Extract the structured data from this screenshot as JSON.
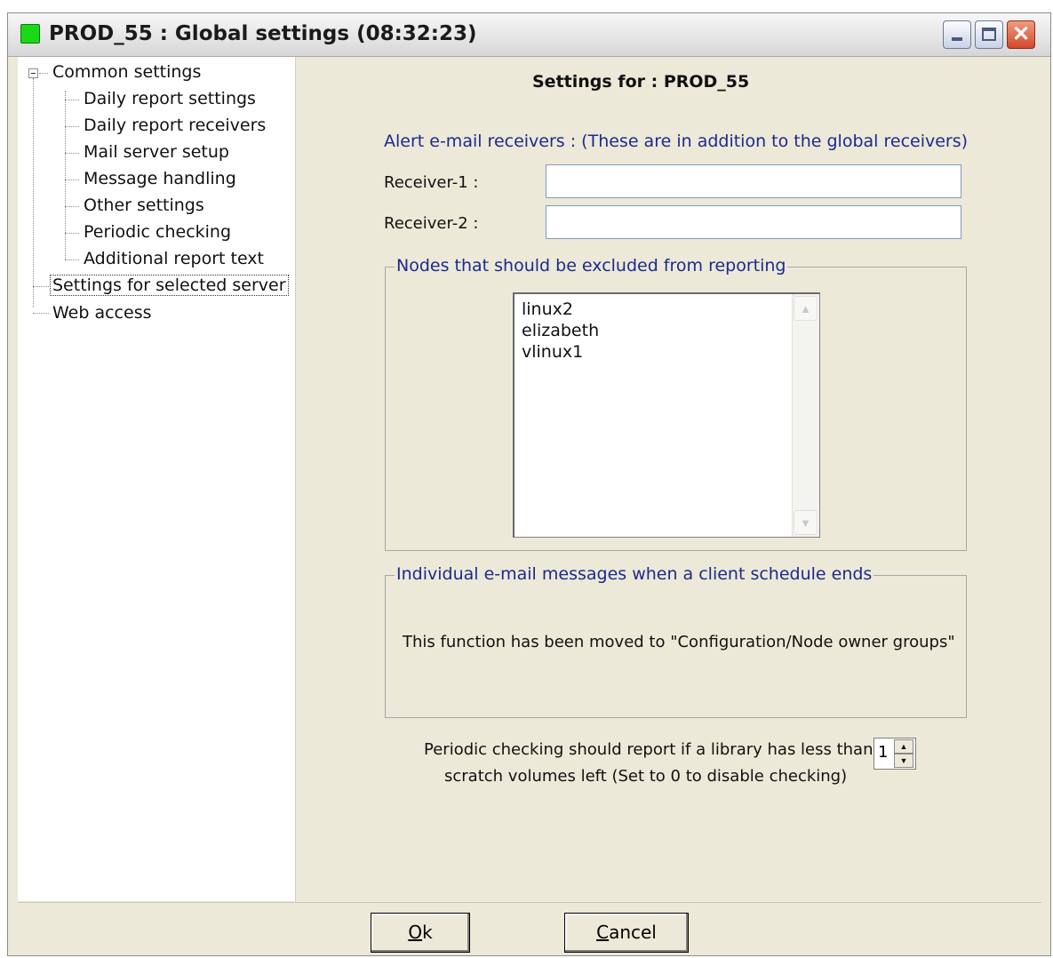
{
  "window": {
    "title": "PROD_55 : Global settings  (08:32:23)",
    "status_color": "#19d919",
    "controls": [
      "minimize",
      "maximize",
      "close"
    ]
  },
  "tree": {
    "root": "Common settings",
    "children": [
      "Daily report settings",
      "Daily report receivers",
      "Mail server setup",
      "Message handling",
      "Other settings",
      "Periodic checking",
      "Additional report text"
    ],
    "selected": "Settings for selected server",
    "web_access": "Web access"
  },
  "panel": {
    "title": "Settings for : PROD_55",
    "alert_heading": "Alert e-mail receivers : (These are in addition to the global receivers)",
    "receiver1_label": "Receiver-1 :",
    "receiver1_value": "",
    "receiver2_label": "Receiver-2 :",
    "receiver2_value": "",
    "nodes_group_title": "Nodes that should be excluded from reporting",
    "nodes": [
      "linux2",
      "elizabeth",
      "vlinux1"
    ],
    "individual_group_title": "Individual e-mail messages when a client schedule ends",
    "individual_message": "This function has been moved to \"Configuration/Node owner groups\"",
    "periodic_line1": "Periodic checking should report if a library has less than",
    "periodic_line2": "scratch volumes left (Set to 0 to disable checking)",
    "periodic_value": "1"
  },
  "footer": {
    "ok_accel": "O",
    "ok_rest": "k",
    "cancel_accel": "C",
    "cancel_rest": "ancel"
  }
}
